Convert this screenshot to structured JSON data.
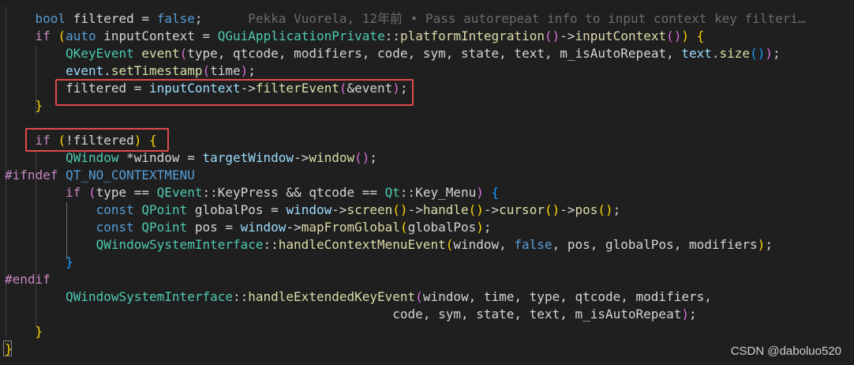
{
  "blame": "Pekka Vuorela, 12年前 • Pass autorepeat info to input context key filteri…",
  "watermark": "CSDN @daboluo520",
  "code": {
    "l1": {
      "a": "bool",
      "b": "filtered",
      "c": "=",
      "d": "false",
      "e": ";"
    },
    "l2": {
      "a": "if",
      "b": "(",
      "c": "auto",
      "d": "inputContext",
      "e": "=",
      "f": "QGuiApplicationPrivate",
      "g": "::",
      "h": "platformIntegration",
      "i": "()",
      "j": "->",
      "k": "inputContext",
      "l": "()",
      "m": ")",
      "n": "{"
    },
    "l3": {
      "a": "QKeyEvent",
      "b": "event",
      "c": "(",
      "d": "type, qtcode, modifiers, code, sym, state, text, m_isAutoRepeat, ",
      "e": "text",
      "f": ".",
      "g": "size",
      "h": "()",
      "i": ")",
      "j": ";"
    },
    "l4": {
      "a": "event",
      "b": ".",
      "c": "setTimestamp",
      "d": "(",
      "e": "time",
      "f": ")",
      "g": ";"
    },
    "l5": {
      "a": "filtered",
      "b": " = ",
      "c": "inputContext",
      "d": "->",
      "e": "filterEvent",
      "f": "(",
      "g": "&event",
      "h": ")",
      "i": ";"
    },
    "l6": {
      "a": "}"
    },
    "l7": {
      "a": "if",
      "b": "(",
      "c": "!filtered",
      "d": ")",
      "e": "{"
    },
    "l8": {
      "a": "QWindow",
      "b": " *window = ",
      "c": "targetWindow",
      "d": "->",
      "e": "window",
      "f": "()",
      "g": ";"
    },
    "l9": {
      "a": "#ifndef",
      "b": "QT_NO_CONTEXTMENU"
    },
    "l10": {
      "a": "if",
      "b": "(",
      "c": "type == ",
      "d": "QEvent",
      "e": "::",
      "f": "KeyPress",
      "g": " && qtcode == ",
      "h": "Qt",
      "i": "::",
      "j": "Key_Menu",
      "k": ")",
      "l": "{"
    },
    "l11": {
      "a": "const",
      "b": "QPoint",
      "c": " globalPos = ",
      "d": "window",
      "e": "->",
      "f": "screen",
      "g": "()",
      "h": "->",
      "i": "handle",
      "j": "()",
      "k": "->",
      "l": "cursor",
      "m": "()",
      "n": "->",
      "o": "pos",
      "p": "()",
      "q": ";"
    },
    "l12": {
      "a": "const",
      "b": "QPoint",
      "c": " pos = ",
      "d": "window",
      "e": "->",
      "f": "mapFromGlobal",
      "g": "(",
      "h": "globalPos",
      "i": ")",
      "j": ";"
    },
    "l13": {
      "a": "QWindowSystemInterface",
      "b": "::",
      "c": "handleContextMenuEvent",
      "d": "(",
      "e": "window, ",
      "f": "false",
      "g": ", pos, globalPos, modifiers",
      "h": ")",
      "i": ";"
    },
    "l14": {
      "a": "}"
    },
    "l15": {
      "a": "#endif"
    },
    "l16": {
      "a": "QWindowSystemInterface",
      "b": "::",
      "c": "handleExtendedKeyEvent",
      "d": "(",
      "e": "window, time, type, qtcode, modifiers,"
    },
    "l17": {
      "a": "code, sym, state, text, m_isAutoRepeat",
      "b": ")",
      "c": ";"
    },
    "l18": {
      "a": "}"
    },
    "l19": {
      "a": "}"
    }
  }
}
